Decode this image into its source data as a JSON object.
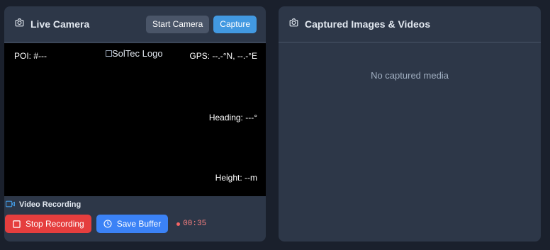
{
  "camera": {
    "title": "Live Camera",
    "icon": "camera-icon",
    "start_label": "Start Camera",
    "capture_label": "Capture",
    "overlay": {
      "poi": "POI: #---",
      "logo_alt": "SolTec Logo",
      "gps": "GPS: --.-°N, --.-°E",
      "heading": "Heading: ---°",
      "height": "Height: --m"
    }
  },
  "recording": {
    "title": "Video Recording",
    "icon": "video-icon",
    "stop_label": "Stop Recording",
    "save_label": "Save Buffer",
    "timer": "00:35"
  },
  "captured": {
    "title": "Captured Images & Videos",
    "icon": "camera-icon",
    "empty_text": "No captured media"
  },
  "colors": {
    "background": "#1a202c",
    "panel": "#2d3748",
    "primary": "#4299e1",
    "danger": "#e53e3e",
    "secondary_button": "#4a5568"
  }
}
